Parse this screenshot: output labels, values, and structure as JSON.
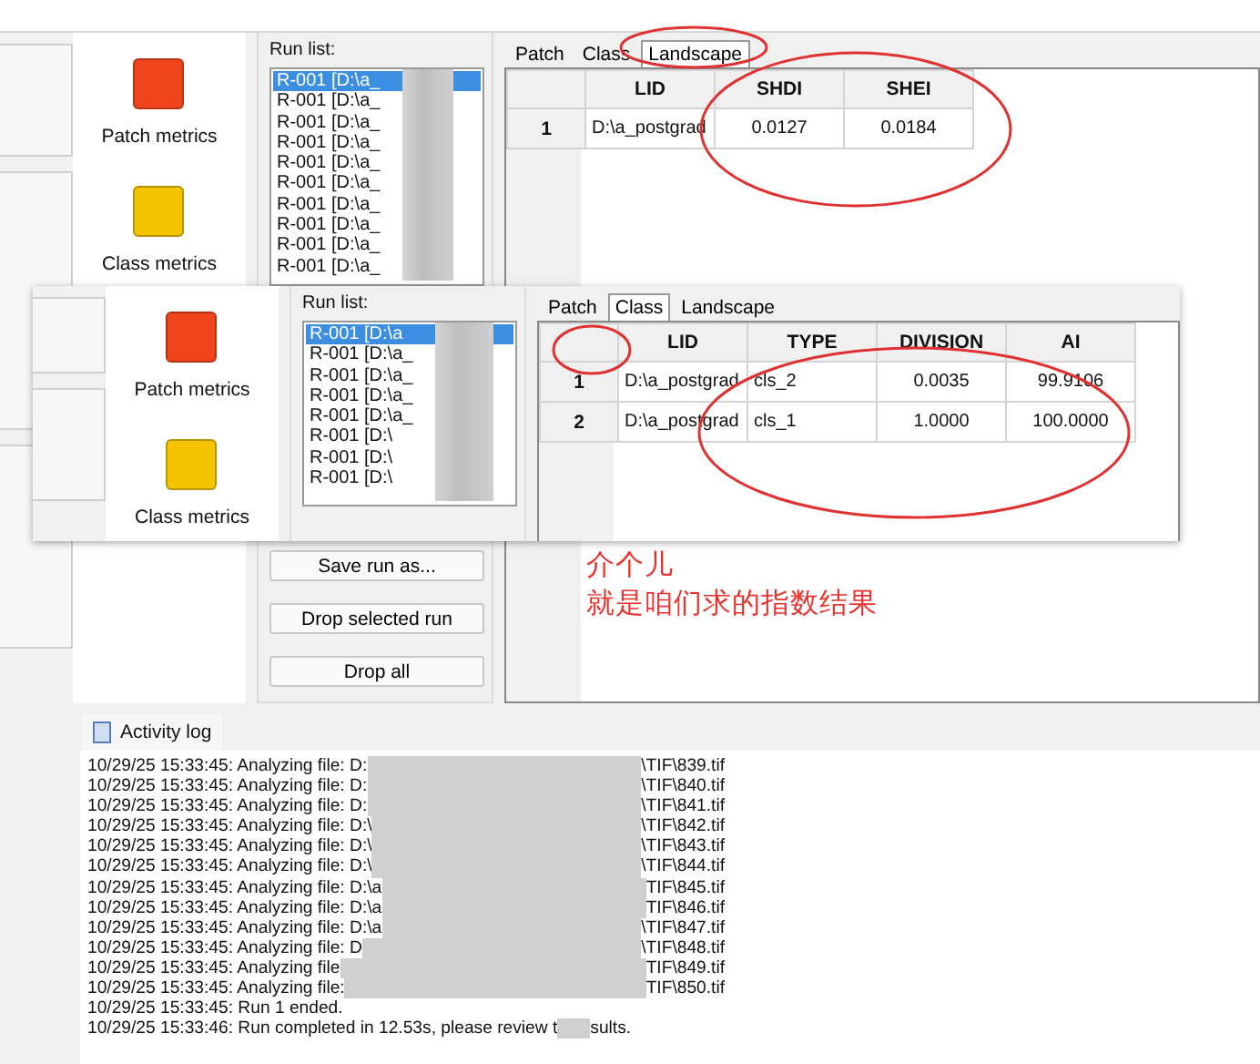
{
  "background_window": {
    "metrics": [
      {
        "label": "Patch metrics",
        "color": "#f0441c"
      },
      {
        "label": "Class metrics",
        "color": "#f5c400"
      }
    ],
    "run_list": {
      "label": "Run list:",
      "items": [
        {
          "text": "R-001 [D:\\a_",
          "selected": true
        },
        {
          "text": "R-001 [D:\\a_",
          "selected": false
        },
        {
          "text": "R-001 [D:\\a_",
          "selected": false
        },
        {
          "text": "R-001 [D:\\a_",
          "selected": false
        },
        {
          "text": "R-001 [D:\\a_",
          "selected": false
        },
        {
          "text": "R-001 [D:\\a_",
          "selected": false
        },
        {
          "text": "R-001 [D:\\a_",
          "selected": false
        },
        {
          "text": "R-001 [D:\\a_",
          "selected": false
        },
        {
          "text": "R-001 [D:\\a_",
          "selected": false
        },
        {
          "text": "R-001 [D:\\a_",
          "selected": false
        }
      ]
    },
    "buttons": [
      "Save run as...",
      "Drop selected run",
      "Drop all"
    ],
    "tabs": [
      {
        "label": "Patch",
        "selected": false
      },
      {
        "label": "Class",
        "selected": false
      },
      {
        "label": "Landscape",
        "selected": true
      }
    ],
    "table": {
      "columns": [
        "LID",
        "SHDI",
        "SHEI"
      ],
      "rows": [
        {
          "number": "1",
          "cells": [
            "D:\\a_postgrad",
            "0.0127",
            "0.0184"
          ]
        }
      ]
    }
  },
  "overlay_window": {
    "metrics": [
      {
        "label": "Patch metrics",
        "color": "#f0441c"
      },
      {
        "label": "Class metrics",
        "color": "#f5c400"
      }
    ],
    "run_list": {
      "label": "Run list:",
      "items": [
        {
          "text": "R-001 [D:\\a",
          "selected": true
        },
        {
          "text": "R-001 [D:\\a_",
          "selected": false
        },
        {
          "text": "R-001 [D:\\a_",
          "selected": false
        },
        {
          "text": "R-001 [D:\\a_",
          "selected": false
        },
        {
          "text": "R-001 [D:\\a_",
          "selected": false
        },
        {
          "text": "R-001 [D:\\",
          "selected": false
        },
        {
          "text": "R-001 [D:\\",
          "selected": false
        },
        {
          "text": "R-001 [D:\\",
          "selected": false
        }
      ]
    },
    "tabs": [
      {
        "label": "Patch",
        "selected": false
      },
      {
        "label": "Class",
        "selected": true
      },
      {
        "label": "Landscape",
        "selected": false
      }
    ],
    "table": {
      "columns": [
        "LID",
        "TYPE",
        "DIVISION",
        "AI"
      ],
      "rows": [
        {
          "number": "1",
          "cells": [
            "D:\\a_postgrad",
            "cls_2",
            "0.0035",
            "99.9106"
          ]
        },
        {
          "number": "2",
          "cells": [
            "D:\\a_postgrad",
            "cls_1",
            "1.0000",
            "100.0000"
          ]
        }
      ]
    }
  },
  "annotation": {
    "lines": [
      "介个儿",
      "就是咱们求的指数结果"
    ]
  },
  "activity_log": {
    "tab": "Activity log",
    "lines": [
      {
        "kind": "file",
        "text": "10/29/25 15:33:45: Analyzing file: D:",
        "suffix": "\\TIF\\839.tif"
      },
      {
        "kind": "file",
        "text": "10/29/25 15:33:45: Analyzing file: D:",
        "suffix": "\\TIF\\840.tif"
      },
      {
        "kind": "file",
        "text": "10/29/25 15:33:45: Analyzing file: D:",
        "suffix": "\\TIF\\841.tif"
      },
      {
        "kind": "file",
        "text": "10/29/25 15:33:45: Analyzing file: D:\\",
        "suffix": "\\TIF\\842.tif"
      },
      {
        "kind": "file",
        "text": "10/29/25 15:33:45: Analyzing file: D:\\",
        "suffix": "\\TIF\\843.tif"
      },
      {
        "kind": "file",
        "text": "10/29/25 15:33:45: Analyzing file: D:\\",
        "suffix": "\\TIF\\844.tif"
      },
      {
        "kind": "file",
        "text": "10/29/25 15:33:45: Analyzing file: D:\\a",
        "suffix": "TIF\\845.tif"
      },
      {
        "kind": "file",
        "text": "10/29/25 15:33:45: Analyzing file: D:\\a",
        "suffix": "TIF\\846.tif"
      },
      {
        "kind": "file",
        "text": "10/29/25 15:33:45: Analyzing file: D:\\a",
        "suffix": "\\TIF\\847.tif"
      },
      {
        "kind": "file",
        "text": "10/29/25 15:33:45: Analyzing file: D",
        "suffix": "\\TIF\\848.tif"
      },
      {
        "kind": "file",
        "text": "10/29/25 15:33:45: Analyzing file",
        "suffix": "TIF\\849.tif"
      },
      {
        "kind": "file",
        "text": "10/29/25 15:33:45: Analyzing file:",
        "suffix": "TIF\\850.tif"
      },
      {
        "kind": "plain",
        "text": "10/29/25 15:33:45: Run 1 ended."
      },
      {
        "kind": "partial",
        "text": "10/29/25 15:33:46: Run completed in 12.53s, please review t",
        "suffix": "sults."
      }
    ]
  }
}
